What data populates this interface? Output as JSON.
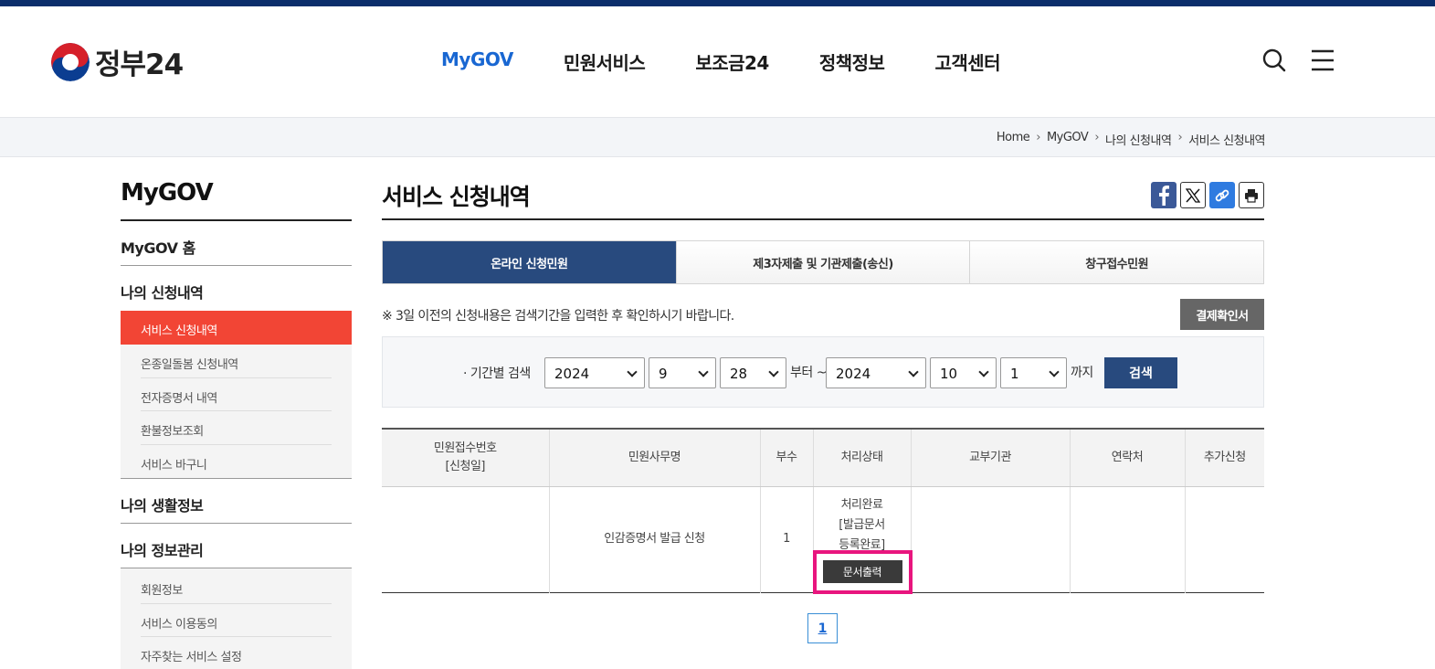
{
  "header": {
    "logo_text": "정부24",
    "nav": [
      "MyGOV",
      "민원서비스",
      "보조금24",
      "정책정보",
      "고객센터"
    ],
    "icons": [
      "search-icon",
      "menu-icon"
    ]
  },
  "breadcrumb": [
    "Home",
    "MyGOV",
    "나의 신청내역",
    "서비스 신청내역"
  ],
  "sidebar": {
    "title": "MyGOV",
    "home": "MyGOV 홈",
    "section1": "나의 신청내역",
    "section1_items": [
      "서비스 신청내역",
      "온종일돌봄 신청내역",
      "전자증명서 내역",
      "환불정보조회",
      "서비스 바구니"
    ],
    "section2": "나의 생활정보",
    "section3": "나의 정보관리",
    "section3_items": [
      "회원정보",
      "서비스 이용동의",
      "자주찾는 서비스 설정"
    ]
  },
  "main": {
    "title": "서비스 신청내역",
    "share_icons": [
      "facebook-icon",
      "x-icon",
      "link-icon",
      "print-icon"
    ],
    "tabs": [
      "온라인 신청민원",
      "제3자제출 및 기관제출(송신)",
      "창구접수민원"
    ],
    "notice": "※ 3일 이전의 신청내용은 검색기간을 입력한 후 확인하시기 바랍니다.",
    "receipt_button": "결제확인서",
    "search": {
      "label": "· 기간별 검색",
      "from_year": "2024",
      "from_month": "9",
      "from_day": "28",
      "from_text": "부터 ~",
      "to_year": "2024",
      "to_month": "10",
      "to_day": "1",
      "to_text": "까지",
      "button": "검색"
    },
    "table": {
      "headers": [
        "민원접수번호",
        "[신청일]",
        "민원사무명",
        "부수",
        "처리상태",
        "교부기관",
        "연락처",
        "추가신청"
      ],
      "row": {
        "number": "",
        "name": "인감증명서 발급 신청",
        "count": "1",
        "status_line1": "처리완료",
        "status_line2": "[발급문서",
        "status_line3": "등록완료]",
        "print_button": "문서출력",
        "agency": "",
        "contact": "",
        "extra": ""
      }
    },
    "pagination": [
      "1"
    ]
  },
  "colors": {
    "topbar": "#0b2e6b",
    "nav_active": "#1967d2",
    "sidebar_active": "#f24535",
    "tab_active": "#284a7e",
    "highlight": "#e8157e"
  }
}
